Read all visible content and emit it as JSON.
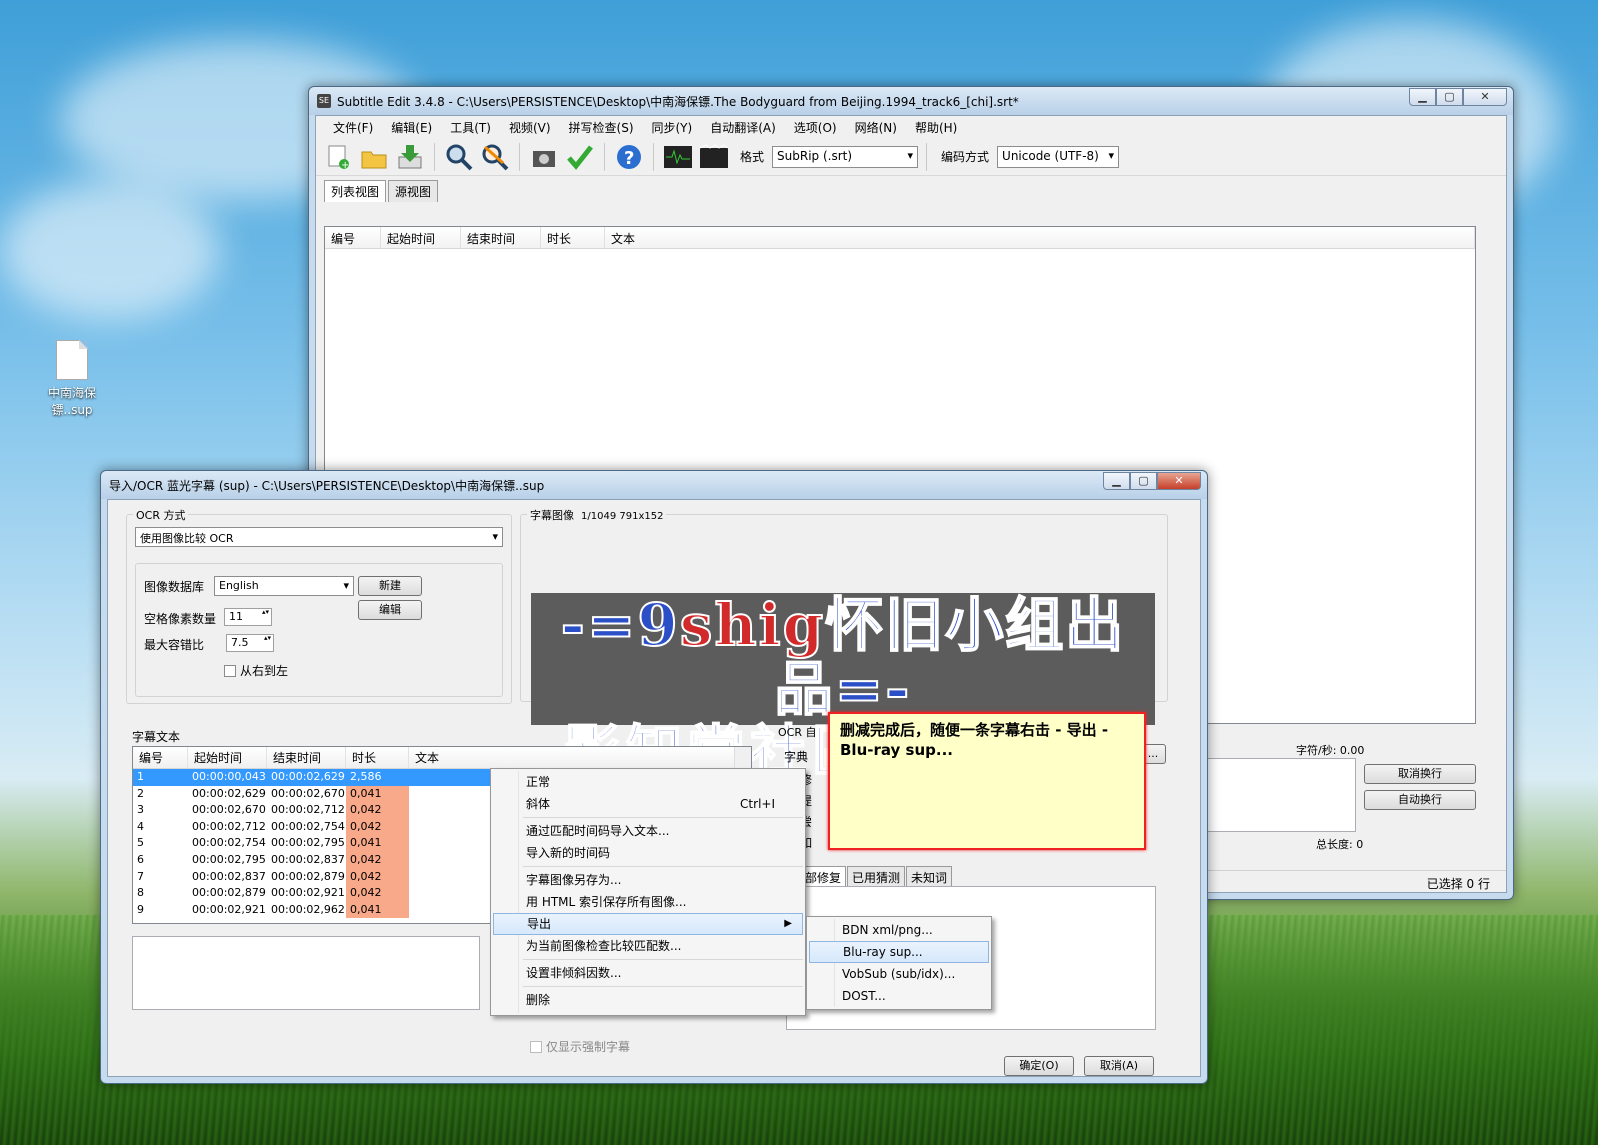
{
  "desktop": {
    "icon_label": "中南海保镖..sup"
  },
  "main_window": {
    "title": "Subtitle Edit 3.4.8 - C:\\Users\\PERSISTENCE\\Desktop\\中南海保镖.The Bodyguard from Beijing.1994_track6_[chi].srt*",
    "menu": [
      "文件(F)",
      "编辑(E)",
      "工具(T)",
      "视频(V)",
      "拼写检查(S)",
      "同步(Y)",
      "自动翻译(A)",
      "选项(O)",
      "网络(N)",
      "帮助(H)"
    ],
    "toolbar": {
      "icons": [
        "new-file-icon",
        "open-folder-icon",
        "save-icon",
        "find-icon",
        "replace-icon",
        "visual-sync-icon",
        "spell-check-icon",
        "help-icon",
        "waveform-icon",
        "video-icon"
      ],
      "format_label": "格式",
      "format_value": "SubRip (.srt)",
      "encoding_label": "编码方式",
      "encoding_value": "Unicode (UTF-8)"
    },
    "tabs": [
      "列表视图",
      "源视图"
    ],
    "columns": [
      "编号",
      "起始时间",
      "结束时间",
      "时长",
      "文本"
    ],
    "chars_per_sec": "字符/秒: 0.00",
    "btn_cancel_wrap": "取消换行",
    "btn_auto_wrap": "自动换行",
    "total_length": "总长度: 0",
    "status_selected": "已选择 0 行"
  },
  "ocr_window": {
    "title": "导入/OCR 蓝光字幕 (sup) - C:\\Users\\PERSISTENCE\\Desktop\\中南海保镖..sup",
    "ocr_method_group": "OCR 方式",
    "ocr_method_value": "使用图像比较 OCR",
    "image_db_label": "图像数据库",
    "image_db_value": "English",
    "btn_new": "新建",
    "btn_edit": "编辑",
    "space_pixels_label": "空格像素数量",
    "space_pixels_value": "11",
    "max_error_label": "最大容错比",
    "max_error_value": "7.5",
    "rtl_label": "从右到左",
    "subtitle_image_group": "字幕图像",
    "image_info": "1/1049   791x152",
    "image_line1_a": "-=9",
    "image_line1_b": "shig",
    "image_line1_c": "怀旧小组出品=-",
    "image_line2": "影知堂社區獨家發佈",
    "subtitle_text_group": "字幕文本",
    "columns": [
      "编号",
      "起始时间",
      "结束时间",
      "时长",
      "文本"
    ],
    "rows": [
      {
        "no": "1",
        "start": "00:00:00,043",
        "end": "00:00:02,629",
        "dur": "2,586"
      },
      {
        "no": "2",
        "start": "00:00:02,629",
        "end": "00:00:02,670",
        "dur": "0,041"
      },
      {
        "no": "3",
        "start": "00:00:02,670",
        "end": "00:00:02,712",
        "dur": "0,042"
      },
      {
        "no": "4",
        "start": "00:00:02,712",
        "end": "00:00:02,754",
        "dur": "0,042"
      },
      {
        "no": "5",
        "start": "00:00:02,754",
        "end": "00:00:02,795",
        "dur": "0,041"
      },
      {
        "no": "6",
        "start": "00:00:02,795",
        "end": "00:00:02,837",
        "dur": "0,042"
      },
      {
        "no": "7",
        "start": "00:00:02,837",
        "end": "00:00:02,879",
        "dur": "0,042"
      },
      {
        "no": "8",
        "start": "00:00:02,879",
        "end": "00:00:02,921",
        "dur": "0,042"
      },
      {
        "no": "9",
        "start": "00:00:02,921",
        "end": "00:00:02,962",
        "dur": "0,041"
      }
    ],
    "ocr_auto_label": "OCR 自",
    "dict_label": "字典",
    "check_letters": [
      "修",
      "提",
      "尝",
      "如"
    ],
    "bottom_tabs": [
      "全部修复",
      "已用猜测",
      "未知词"
    ],
    "forced_only_label": "仅显示强制字幕",
    "btn_ok": "确定(O)",
    "btn_cancel": "取消(A)",
    "btn_browse": "..."
  },
  "context_menu": {
    "items": [
      {
        "label": "正常"
      },
      {
        "label": "斜体",
        "shortcut": "Ctrl+I"
      },
      {
        "label": "通过匹配时间码导入文本..."
      },
      {
        "label": "导入新的时间码"
      },
      {
        "label": "字幕图像另存为..."
      },
      {
        "label": "用 HTML 索引保存所有图像..."
      },
      {
        "label": "导出"
      },
      {
        "label": "为当前图像检查比较匹配数..."
      },
      {
        "label": "设置非倾斜因数..."
      },
      {
        "label": "删除"
      }
    ]
  },
  "export_submenu": [
    "BDN xml/png...",
    "Blu-ray sup...",
    "VobSub (sub/idx)...",
    "DOST..."
  ],
  "annotation_note": "删减完成后，随便一条字幕右击 - 导出 - Blu-ray sup..."
}
